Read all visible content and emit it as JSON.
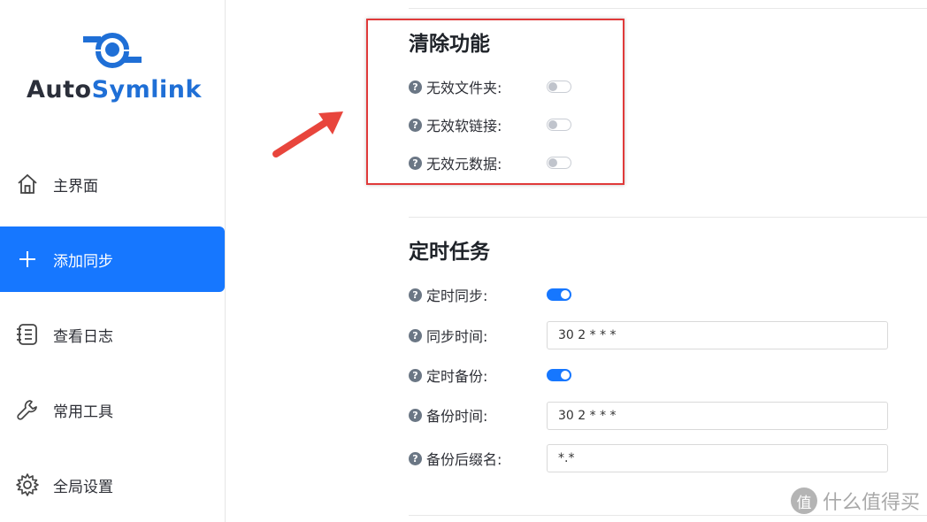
{
  "logo": {
    "part1": "Auto",
    "part2": "Symlink"
  },
  "nav": [
    {
      "label": "主界面",
      "icon": "home-icon"
    },
    {
      "label": "添加同步",
      "icon": "plus-icon",
      "active": true
    },
    {
      "label": "查看日志",
      "icon": "log-list-icon"
    },
    {
      "label": "常用工具",
      "icon": "wrench-icon"
    },
    {
      "label": "全局设置",
      "icon": "gear-icon"
    }
  ],
  "cleanup": {
    "title": "清除功能",
    "items": [
      {
        "label": "无效文件夹:",
        "enabled": false
      },
      {
        "label": "无效软链接:",
        "enabled": false
      },
      {
        "label": "无效元数据:",
        "enabled": false
      }
    ]
  },
  "schedule": {
    "title": "定时任务",
    "sync_label": "定时同步:",
    "sync_enabled": true,
    "sync_time_label": "同步时间:",
    "sync_time_value": "30 2 * * *",
    "backup_label": "定时备份:",
    "backup_enabled": true,
    "backup_time_label": "备份时间:",
    "backup_time_value": "30 2 * * *",
    "backup_suffix_label": "备份后缀名:",
    "backup_suffix_value": "*.*"
  },
  "help_glyph": "?",
  "watermark": {
    "text": "什么值得买",
    "icon_glyph": "值"
  },
  "colors": {
    "accent": "#1677ff",
    "brand": "#1f6fd6",
    "highlight": "#e03a3a"
  }
}
